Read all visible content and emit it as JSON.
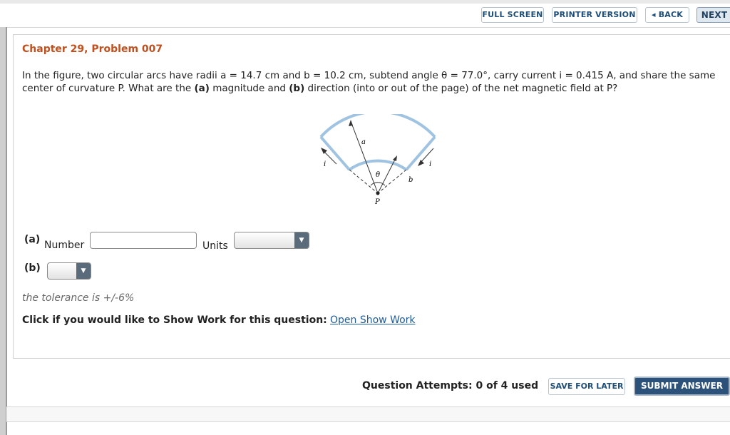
{
  "toolbar": {
    "full_screen": "FULL SCREEN",
    "printer_version": "PRINTER VERSION",
    "back": "◂ BACK",
    "next": "NEXT"
  },
  "problem": {
    "title": "Chapter 29, Problem 007",
    "line1": "In the figure, two circular arcs have radii a = 14.7 cm and b = 10.2 cm, subtend angle θ = 77.0°, carry current i = 0.415 A, and share the same",
    "line2_pre": "center of curvature P. What are the ",
    "part_a": "(a)",
    "line2_mid": " magnitude and ",
    "part_b": "(b)",
    "line2_post": " direction (into or out of the page) of the net magnetic field at P?"
  },
  "figure": {
    "label_a": "a",
    "label_b": "b",
    "label_theta": "θ",
    "label_i_left": "i",
    "label_i_right": "i",
    "label_p": "P"
  },
  "answer": {
    "a_label": "(a)",
    "number_label": "Number",
    "number_value": "",
    "units_label": "Units",
    "units_value": "",
    "b_label": "(b)",
    "b_value": ""
  },
  "tolerance": "the tolerance is +/-6%",
  "show_work": {
    "prompt": "Click if you would like to Show Work for this question:",
    "link": "Open Show Work"
  },
  "footer": {
    "attempts": "Question Attempts: 0 of 4 used",
    "save": "SAVE FOR LATER",
    "submit": "SUBMIT ANSWER"
  },
  "colors": {
    "title": "#c0501f",
    "link": "#1f5c99",
    "submit_bg": "#2d5279",
    "arc": "#9fc3e0"
  }
}
